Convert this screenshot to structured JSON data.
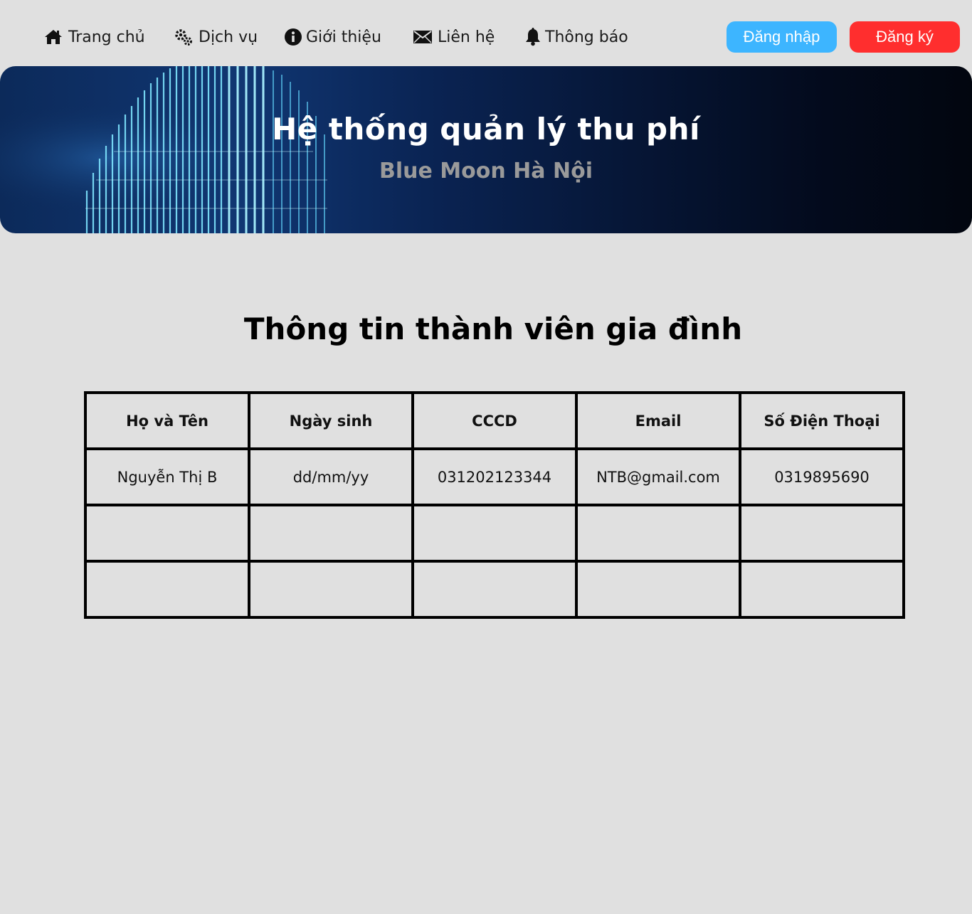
{
  "nav": {
    "items": [
      {
        "label": "Trang chủ",
        "icon": "home-icon"
      },
      {
        "label": "Dịch vụ",
        "icon": "gears-icon"
      },
      {
        "label": "Giới thiệu",
        "icon": "info-icon"
      },
      {
        "label": "Liên hệ",
        "icon": "envelope-icon"
      },
      {
        "label": "Thông báo",
        "icon": "bell-icon"
      }
    ],
    "login_label": "Đăng nhập",
    "register_label": "Đăng ký"
  },
  "hero": {
    "title": "Hệ thống quản lý thu phí",
    "subtitle": "Blue Moon Hà Nội"
  },
  "main": {
    "title": "Thông tin thành viên gia đình",
    "table": {
      "headers": [
        "Họ và Tên",
        "Ngày sinh",
        "CCCD",
        "Email",
        "Số Điện Thoại"
      ],
      "rows": [
        [
          "Nguyễn Thị B",
          "dd/mm/yy",
          "031202123344",
          "NTB@gmail.com",
          "0319895690"
        ],
        [
          "",
          "",
          "",
          "",
          ""
        ],
        [
          "",
          "",
          "",
          "",
          ""
        ]
      ]
    }
  },
  "colors": {
    "background": "#e0e0e0",
    "login_button": "#3db5ff",
    "register_button": "#ff2e2e",
    "hero_dark": "#02060f",
    "hero_blue": "#103672"
  }
}
